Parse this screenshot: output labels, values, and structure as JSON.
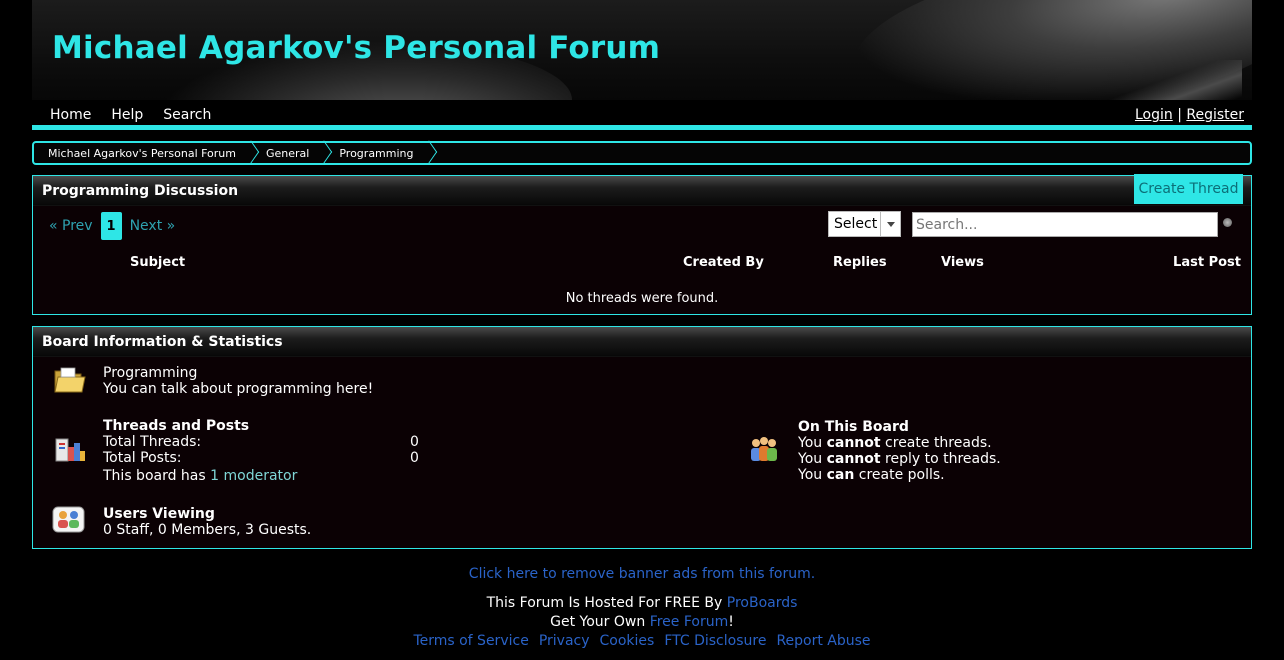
{
  "forum": {
    "title": "Michael Agarkov's Personal Forum"
  },
  "nav": {
    "items": [
      "Home",
      "Help",
      "Search"
    ],
    "login": "Login",
    "separator": "|",
    "register": "Register"
  },
  "breadcrumb": [
    "Michael Agarkov's Personal Forum",
    "General",
    "Programming"
  ],
  "threads": {
    "title": "Programming Discussion",
    "create_button": "Create Thread",
    "pager": {
      "prev": "« Prev",
      "current": "1",
      "next": "Next »"
    },
    "select_label": "Select",
    "search_placeholder": "Search...",
    "columns": {
      "subject": "Subject",
      "created_by": "Created By",
      "replies": "Replies",
      "views": "Views",
      "last_post": "Last Post"
    },
    "empty_message": "No threads were found."
  },
  "board_info": {
    "title": "Board Information & Statistics",
    "board_name": "Programming",
    "board_desc": "You can talk about programming here!",
    "threads_posts_title": "Threads and Posts",
    "total_threads_label": "Total Threads:",
    "total_threads_value": "0",
    "total_posts_label": "Total Posts:",
    "total_posts_value": "0",
    "moderator_prefix": "This board has",
    "moderator_link": "1 moderator",
    "on_board_title": "On This Board",
    "perm_1": {
      "pre": "You",
      "strong": "cannot",
      "post": "create threads."
    },
    "perm_2": {
      "pre": "You",
      "strong": "cannot",
      "post": "reply to threads."
    },
    "perm_3": {
      "pre": "You",
      "strong": "can",
      "post": "create polls."
    },
    "users_viewing_title": "Users Viewing",
    "users_viewing_text": "0 Staff, 0 Members, 3 Guests."
  },
  "footer": {
    "remove_ads": "Click here to remove banner ads from this forum.",
    "hosted_prefix": "This Forum Is Hosted For FREE By",
    "hosted_link": "ProBoards",
    "get_own_prefix": "Get Your Own",
    "get_own_link": "Free Forum",
    "get_own_suffix": "!",
    "links": [
      "Terms of Service",
      "Privacy",
      "Cookies",
      "FTC Disclosure",
      "Report Abuse"
    ]
  },
  "colors": {
    "accent": "#2ee6e6",
    "link": "#2a63c8",
    "panel": "#0b0104"
  }
}
